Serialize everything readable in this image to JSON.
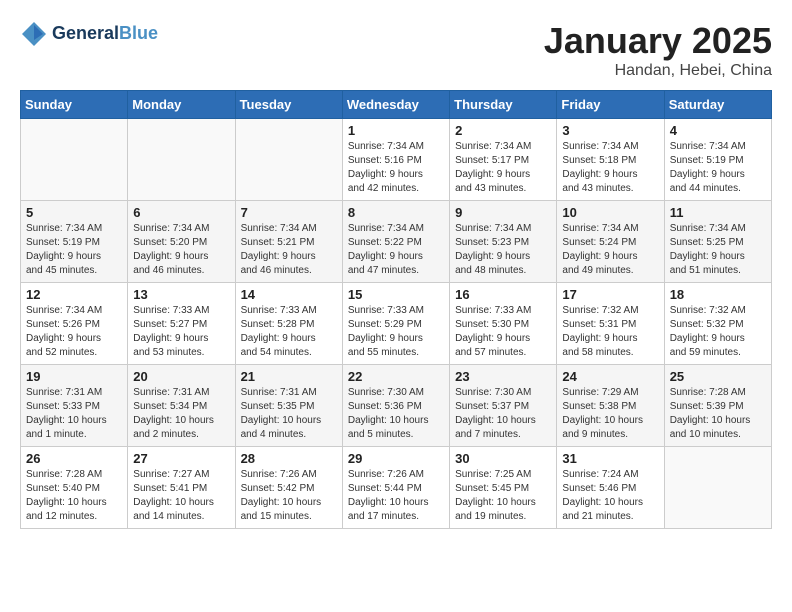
{
  "header": {
    "logo_line1": "General",
    "logo_line2": "Blue",
    "month": "January 2025",
    "location": "Handan, Hebei, China"
  },
  "weekdays": [
    "Sunday",
    "Monday",
    "Tuesday",
    "Wednesday",
    "Thursday",
    "Friday",
    "Saturday"
  ],
  "weeks": [
    [
      {
        "day": "",
        "info": ""
      },
      {
        "day": "",
        "info": ""
      },
      {
        "day": "",
        "info": ""
      },
      {
        "day": "1",
        "info": "Sunrise: 7:34 AM\nSunset: 5:16 PM\nDaylight: 9 hours\nand 42 minutes."
      },
      {
        "day": "2",
        "info": "Sunrise: 7:34 AM\nSunset: 5:17 PM\nDaylight: 9 hours\nand 43 minutes."
      },
      {
        "day": "3",
        "info": "Sunrise: 7:34 AM\nSunset: 5:18 PM\nDaylight: 9 hours\nand 43 minutes."
      },
      {
        "day": "4",
        "info": "Sunrise: 7:34 AM\nSunset: 5:19 PM\nDaylight: 9 hours\nand 44 minutes."
      }
    ],
    [
      {
        "day": "5",
        "info": "Sunrise: 7:34 AM\nSunset: 5:19 PM\nDaylight: 9 hours\nand 45 minutes."
      },
      {
        "day": "6",
        "info": "Sunrise: 7:34 AM\nSunset: 5:20 PM\nDaylight: 9 hours\nand 46 minutes."
      },
      {
        "day": "7",
        "info": "Sunrise: 7:34 AM\nSunset: 5:21 PM\nDaylight: 9 hours\nand 46 minutes."
      },
      {
        "day": "8",
        "info": "Sunrise: 7:34 AM\nSunset: 5:22 PM\nDaylight: 9 hours\nand 47 minutes."
      },
      {
        "day": "9",
        "info": "Sunrise: 7:34 AM\nSunset: 5:23 PM\nDaylight: 9 hours\nand 48 minutes."
      },
      {
        "day": "10",
        "info": "Sunrise: 7:34 AM\nSunset: 5:24 PM\nDaylight: 9 hours\nand 49 minutes."
      },
      {
        "day": "11",
        "info": "Sunrise: 7:34 AM\nSunset: 5:25 PM\nDaylight: 9 hours\nand 51 minutes."
      }
    ],
    [
      {
        "day": "12",
        "info": "Sunrise: 7:34 AM\nSunset: 5:26 PM\nDaylight: 9 hours\nand 52 minutes."
      },
      {
        "day": "13",
        "info": "Sunrise: 7:33 AM\nSunset: 5:27 PM\nDaylight: 9 hours\nand 53 minutes."
      },
      {
        "day": "14",
        "info": "Sunrise: 7:33 AM\nSunset: 5:28 PM\nDaylight: 9 hours\nand 54 minutes."
      },
      {
        "day": "15",
        "info": "Sunrise: 7:33 AM\nSunset: 5:29 PM\nDaylight: 9 hours\nand 55 minutes."
      },
      {
        "day": "16",
        "info": "Sunrise: 7:33 AM\nSunset: 5:30 PM\nDaylight: 9 hours\nand 57 minutes."
      },
      {
        "day": "17",
        "info": "Sunrise: 7:32 AM\nSunset: 5:31 PM\nDaylight: 9 hours\nand 58 minutes."
      },
      {
        "day": "18",
        "info": "Sunrise: 7:32 AM\nSunset: 5:32 PM\nDaylight: 9 hours\nand 59 minutes."
      }
    ],
    [
      {
        "day": "19",
        "info": "Sunrise: 7:31 AM\nSunset: 5:33 PM\nDaylight: 10 hours\nand 1 minute."
      },
      {
        "day": "20",
        "info": "Sunrise: 7:31 AM\nSunset: 5:34 PM\nDaylight: 10 hours\nand 2 minutes."
      },
      {
        "day": "21",
        "info": "Sunrise: 7:31 AM\nSunset: 5:35 PM\nDaylight: 10 hours\nand 4 minutes."
      },
      {
        "day": "22",
        "info": "Sunrise: 7:30 AM\nSunset: 5:36 PM\nDaylight: 10 hours\nand 5 minutes."
      },
      {
        "day": "23",
        "info": "Sunrise: 7:30 AM\nSunset: 5:37 PM\nDaylight: 10 hours\nand 7 minutes."
      },
      {
        "day": "24",
        "info": "Sunrise: 7:29 AM\nSunset: 5:38 PM\nDaylight: 10 hours\nand 9 minutes."
      },
      {
        "day": "25",
        "info": "Sunrise: 7:28 AM\nSunset: 5:39 PM\nDaylight: 10 hours\nand 10 minutes."
      }
    ],
    [
      {
        "day": "26",
        "info": "Sunrise: 7:28 AM\nSunset: 5:40 PM\nDaylight: 10 hours\nand 12 minutes."
      },
      {
        "day": "27",
        "info": "Sunrise: 7:27 AM\nSunset: 5:41 PM\nDaylight: 10 hours\nand 14 minutes."
      },
      {
        "day": "28",
        "info": "Sunrise: 7:26 AM\nSunset: 5:42 PM\nDaylight: 10 hours\nand 15 minutes."
      },
      {
        "day": "29",
        "info": "Sunrise: 7:26 AM\nSunset: 5:44 PM\nDaylight: 10 hours\nand 17 minutes."
      },
      {
        "day": "30",
        "info": "Sunrise: 7:25 AM\nSunset: 5:45 PM\nDaylight: 10 hours\nand 19 minutes."
      },
      {
        "day": "31",
        "info": "Sunrise: 7:24 AM\nSunset: 5:46 PM\nDaylight: 10 hours\nand 21 minutes."
      },
      {
        "day": "",
        "info": ""
      }
    ]
  ]
}
